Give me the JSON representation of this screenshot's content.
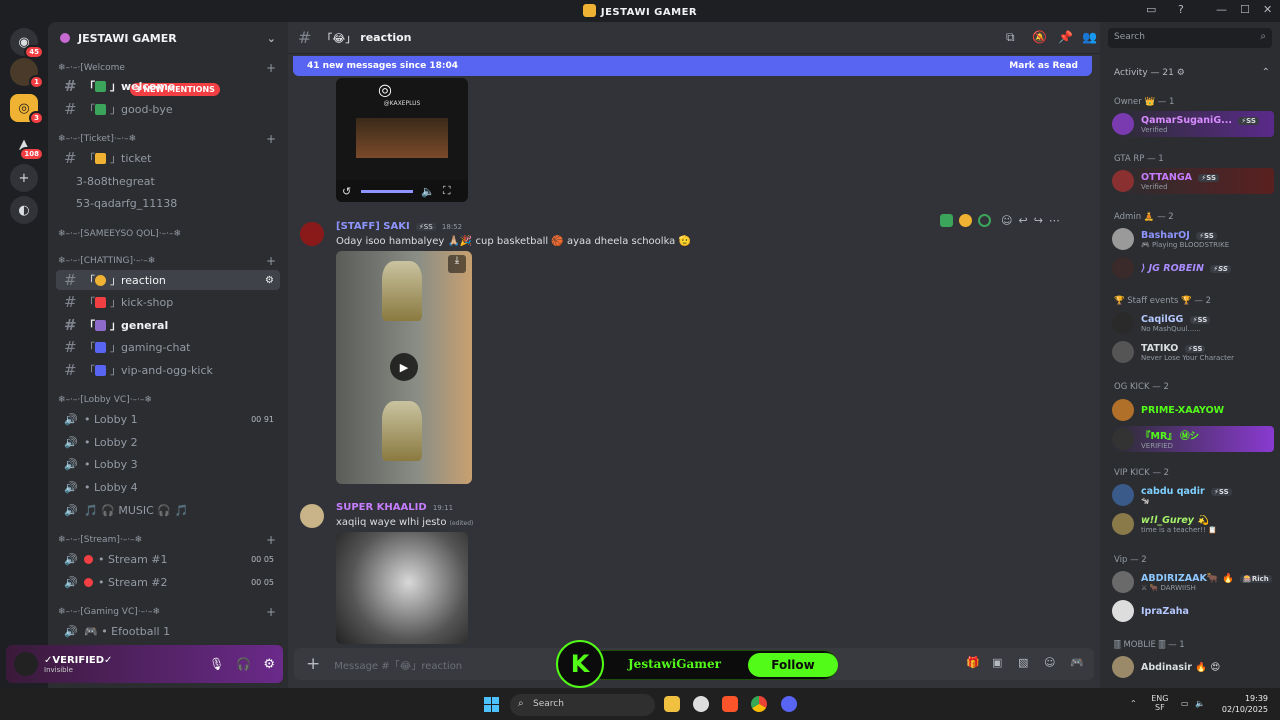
{
  "window": {
    "title": "JESTAWI GAMER",
    "minimize": "—",
    "maximize": "☐",
    "close": "✕"
  },
  "guilds": {
    "badges": [
      "45",
      "1",
      "3",
      "108"
    ]
  },
  "server": {
    "name": "JESTAWI GAMER",
    "mention_pill": "3 NEW MENTIONS",
    "categories": {
      "welcome": "❄–·–·[Welcome",
      "ticket": "❄–·–·[Ticket]·–·–❄",
      "sameeyso": "❄–·–·[SAMEEYSO QOL]·–·–❄",
      "chatting": "❄–·–·[CHATTING]·–·–❄",
      "lobby": "❄–·–·[Lobby VC]·–·–❄",
      "stream": "❄–·–·[Stream]·–·–❄",
      "gaming": "❄–·–·[Gaming VC]·–·–❄"
    },
    "channels": {
      "welcome": "welcome",
      "goodbye": "good-bye",
      "ticket": "ticket",
      "t1": "3-8o8thegreat",
      "t2": "53-qadarfg_11138",
      "reaction": "reaction",
      "kickshop": "kick-shop",
      "general": "general",
      "gamingchat": "gaming-chat",
      "vipkick": "vip-and-ogg-kick",
      "lobby1": "• Lobby 1",
      "lobby1_ctr": "00 91",
      "lobby2": "• Lobby 2",
      "lobby3": "• Lobby 3",
      "lobby4": "• Lobby 4",
      "music": "🎵 🎧 MUSIC 🎧 🎵",
      "stream1": "• Stream #1",
      "stream1_ctr": "00 05",
      "stream2": "• Stream #2",
      "stream2_ctr": "00 05",
      "efootball": "🎮 • Efootball 1"
    }
  },
  "user_panel": {
    "name": "✓VERIFIED✓",
    "status": "Invisible"
  },
  "chat": {
    "channel": "reaction",
    "new_messages": "41 new messages since 18:04",
    "mark_read": "Mark as Read",
    "insta_handle": "@KAXEPLUS",
    "messages": [
      {
        "author": "[STAFF] SAKI",
        "tag": "⚡SS",
        "time": "18:52",
        "text": "Oday isoo hambalyey 🙏🏼🎉 cup basketball 🏀 ayaa dheela schoolka 🫡"
      },
      {
        "author": "SUPER KHAALID",
        "time": "19:11",
        "text": "xaqiiq waye wlhi jesto",
        "edited": "(edited)"
      }
    ],
    "composer_placeholder": "Message #「😂」reaction"
  },
  "kick": {
    "name": "JestawiGamer",
    "follow": "Follow",
    "logo": "K"
  },
  "members": {
    "search_placeholder": "Search",
    "activity": "Activity — 21 ⚙",
    "sections": [
      {
        "title": "Owner 👑 — 1",
        "members": [
          {
            "name": "QamarSuganiG...",
            "tag": "⚡SS",
            "sub": "Verified"
          }
        ]
      },
      {
        "title": "GTA RP — 1",
        "members": [
          {
            "name": "OTTANGA",
            "tag": "⚡SS",
            "sub": "Verified"
          }
        ]
      },
      {
        "title": "Admin 🧘 — 2",
        "members": [
          {
            "name": "BasharOJ",
            "tag": "⚡SS",
            "sub": "🎮 Playing BLOODSTRIKE"
          },
          {
            "name": "⟩ JG ROBEIN",
            "tag": "⚡SS",
            "sub": ""
          }
        ]
      },
      {
        "title": "🏆 Staff events 🏆 — 2",
        "members": [
          {
            "name": "CaqilGG",
            "tag": "⚡SS",
            "sub": "No MashQuul......"
          },
          {
            "name": "TATIKO",
            "tag": "⚡SS",
            "sub": "Never Lose Your Character"
          }
        ]
      },
      {
        "title": "OG KICK — 2",
        "members": [
          {
            "name": "PRIME-XAAYOW",
            "tag": "",
            "sub": ""
          },
          {
            "name": "『MR』 Ⓜシ",
            "tag": "",
            "sub": "VERIFIED"
          }
        ]
      },
      {
        "title": "VIP KICK — 2",
        "members": [
          {
            "name": "cabdu qadir",
            "tag": "⚡SS",
            "sub": "🐄"
          },
          {
            "name": "w!l_Gurey 💫",
            "tag": "",
            "sub": "time is a teacher!! 📋"
          }
        ]
      },
      {
        "title": "Vip — 2",
        "members": [
          {
            "name": "ABDIRIZAAK🐂 🔥",
            "tag": "🎰Rich",
            "sub": "⚔ 🐂 DARWIISH"
          },
          {
            "name": "IpraZaha",
            "tag": "",
            "sub": ""
          }
        ]
      },
      {
        "title": "🀫 MOBLIE 🀫 — 1",
        "members": [
          {
            "name": "Abdinasir 🔥 😍",
            "tag": "",
            "sub": ""
          }
        ]
      }
    ]
  },
  "taskbar": {
    "search": "Search",
    "lang": "ENG",
    "region": "SF",
    "time": "19:39",
    "date": "02/10/2025"
  },
  "colors": {
    "accent": "#5865f2",
    "kick": "#53fc18",
    "mention": "#f23f43"
  }
}
